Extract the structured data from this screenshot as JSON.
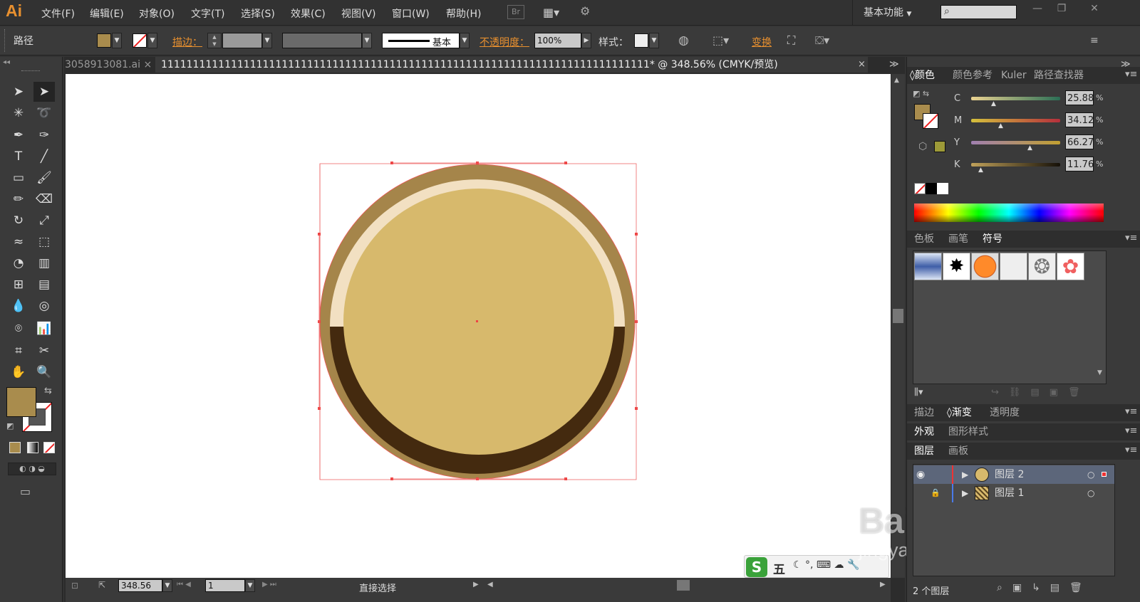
{
  "app": {
    "logo": "Ai",
    "workspace": "基本功能"
  },
  "menu": [
    "文件(F)",
    "编辑(E)",
    "对象(O)",
    "文字(T)",
    "选择(S)",
    "效果(C)",
    "视图(V)",
    "窗口(W)",
    "帮助(H)"
  ],
  "menu_extra": {
    "br": "Br"
  },
  "control": {
    "object_label": "路径",
    "stroke_label": "描边：",
    "stroke_style": "基本",
    "opacity_label": "不透明度：",
    "opacity_value": "100%",
    "style_label": "样式：",
    "transform_label": "变换"
  },
  "tabs": [
    {
      "label": "3058913081.ai",
      "active": false
    },
    {
      "label": "11111111111111111111111111111111111111111111111111111111111111111111111111111* @ 348.56% (CMYK/预览)",
      "active": true
    }
  ],
  "colors": {
    "fill": "#a98c4d",
    "outer_ring": "#a5854a",
    "highlight": "#f2e0c2",
    "shadow": "#442a0f",
    "face": "#d7b96c",
    "accent": "#e8902f"
  },
  "color_panel": {
    "tabs": [
      "颜色",
      "颜色参考",
      "Kuler",
      "路径查找器"
    ],
    "channels": [
      {
        "name": "C",
        "value": "25.88",
        "pct": 0.26
      },
      {
        "name": "M",
        "value": "34.12",
        "pct": 0.34
      },
      {
        "name": "Y",
        "value": "66.27",
        "pct": 0.66
      },
      {
        "name": "K",
        "value": "11.76",
        "pct": 0.12
      }
    ],
    "unit": "%"
  },
  "swatch_panel": {
    "tabs": [
      "色板",
      "画笔",
      "符号"
    ]
  },
  "gradient_panel": {
    "tabs": [
      "描边",
      "渐变",
      "透明度"
    ]
  },
  "appearance_panel": {
    "tabs": [
      "外观",
      "图形样式"
    ]
  },
  "layers_panel": {
    "tabs": [
      "图层",
      "画板"
    ],
    "layers": [
      {
        "name": "图层 2"
      },
      {
        "name": "图层 1"
      }
    ],
    "count": "2 个图层"
  },
  "status": {
    "zoom": "348.56",
    "artboard": "1",
    "tool": "直接选择"
  },
  "ime": {
    "mode": "五"
  },
  "watermark": {
    "brand": "Baidu经验",
    "url": "jingyan.baidu.com"
  }
}
